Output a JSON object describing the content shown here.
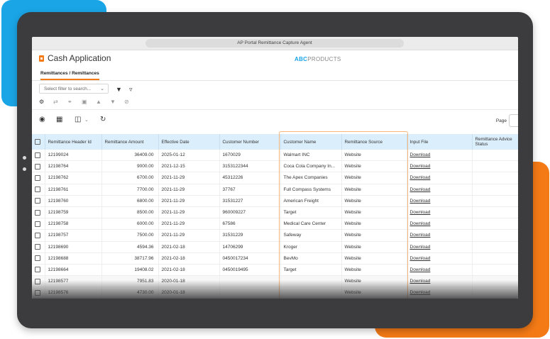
{
  "window": {
    "title": "AP Portal Remittance Capture Agent"
  },
  "app": {
    "title": "Cash Application",
    "brand_strong": "ABC",
    "brand_rest": "PRODUCTS"
  },
  "tabs": [
    {
      "label": "Remittances / Remittances"
    }
  ],
  "filter": {
    "placeholder": "Select filter to search..."
  },
  "pager": {
    "label": "Page"
  },
  "table": {
    "columns": [
      "Remittance Header Id",
      "Remittance Amount",
      "Effective Date",
      "Customer Number",
      "Customer Name",
      "Remittance Source",
      "Input File",
      "Remittance Advice Status"
    ],
    "rows": [
      {
        "id": "12199024",
        "amount": "36409.00",
        "date": "2025-01-12",
        "cust_no": "1670029",
        "cust_name": "Walmart INC",
        "source": "Website",
        "file": "Download"
      },
      {
        "id": "12198764",
        "amount": "9000.00",
        "date": "2021-12-15",
        "cust_no": "3153122344",
        "cust_name": "Coca Cola Company In...",
        "source": "Website",
        "file": "Download"
      },
      {
        "id": "12198762",
        "amount": "6700.00",
        "date": "2021-11-29",
        "cust_no": "45312226",
        "cust_name": "The Apex Companies",
        "source": "Website",
        "file": "Download"
      },
      {
        "id": "12198761",
        "amount": "7700.00",
        "date": "2021-11-29",
        "cust_no": "37767",
        "cust_name": "Full Compass Systems",
        "source": "Website",
        "file": "Download"
      },
      {
        "id": "12198760",
        "amount": "6800.00",
        "date": "2021-11-29",
        "cust_no": "31531227",
        "cust_name": "American Freight",
        "source": "Website",
        "file": "Download"
      },
      {
        "id": "12198759",
        "amount": "8500.00",
        "date": "2021-11-29",
        "cust_no": "960009227",
        "cust_name": "Target",
        "source": "Website",
        "file": "Download"
      },
      {
        "id": "12198758",
        "amount": "6000.00",
        "date": "2021-11-29",
        "cust_no": "67586",
        "cust_name": "Medical Care Center",
        "source": "Website",
        "file": "Download"
      },
      {
        "id": "12198757",
        "amount": "7500.00",
        "date": "2021-11-29",
        "cust_no": "31531229",
        "cust_name": "Safeway",
        "source": "Website",
        "file": "Download"
      },
      {
        "id": "12198690",
        "amount": "4594.36",
        "date": "2021-02-18",
        "cust_no": "14706299",
        "cust_name": "Kroger",
        "source": "Website",
        "file": "Download"
      },
      {
        "id": "12198688",
        "amount": "38717.96",
        "date": "2021-02-18",
        "cust_no": "0450017234",
        "cust_name": "BevMo",
        "source": "Website",
        "file": "Download"
      },
      {
        "id": "12198664",
        "amount": "19408.02",
        "date": "2021-02-18",
        "cust_no": "0450019495",
        "cust_name": "Target",
        "source": "Website",
        "file": "Download"
      },
      {
        "id": "12198577",
        "amount": "7951.83",
        "date": "2020-01-18",
        "cust_no": "",
        "cust_name": "",
        "source": "Website",
        "file": "Download"
      },
      {
        "id": "12198576",
        "amount": "4730.00",
        "date": "2020-01-18",
        "cust_no": "",
        "cust_name": "",
        "source": "Website",
        "file": "Download"
      }
    ]
  },
  "colors": {
    "accent": "#f47a16",
    "blue": "#1aa5e6",
    "header_bg": "#dbeefb"
  }
}
